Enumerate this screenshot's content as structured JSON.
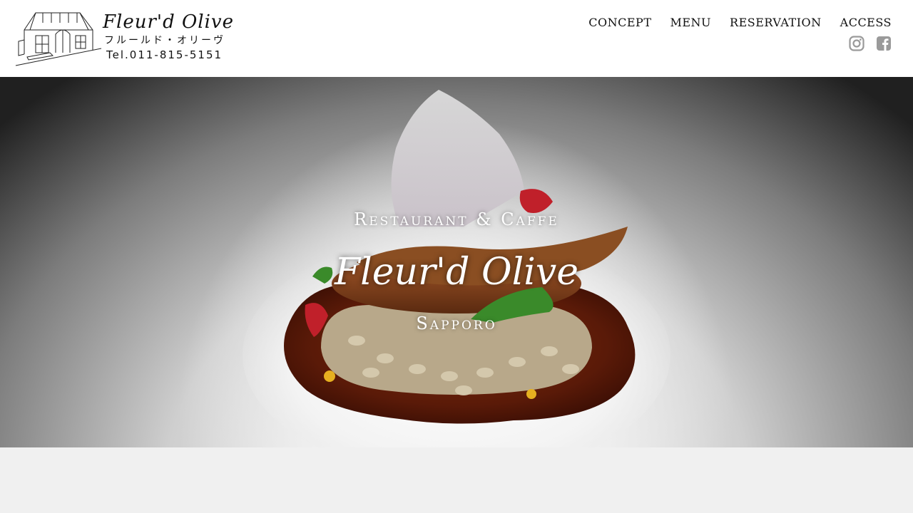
{
  "brand": {
    "name": "Fleur'd Olive",
    "kana": "フルールド・オリーヴ",
    "tel": "Tel.011-815-5151"
  },
  "nav": {
    "items": [
      {
        "label": "CONCEPT"
      },
      {
        "label": "MENU"
      },
      {
        "label": "RESERVATION"
      },
      {
        "label": "ACCESS"
      }
    ]
  },
  "social": {
    "icons": [
      "instagram-icon",
      "facebook-icon"
    ],
    "color": "#9a9a9a"
  },
  "hero": {
    "subtitle": "Restaurant & Caffe",
    "title": "Fleur'd Olive",
    "city": "Sapporo"
  }
}
